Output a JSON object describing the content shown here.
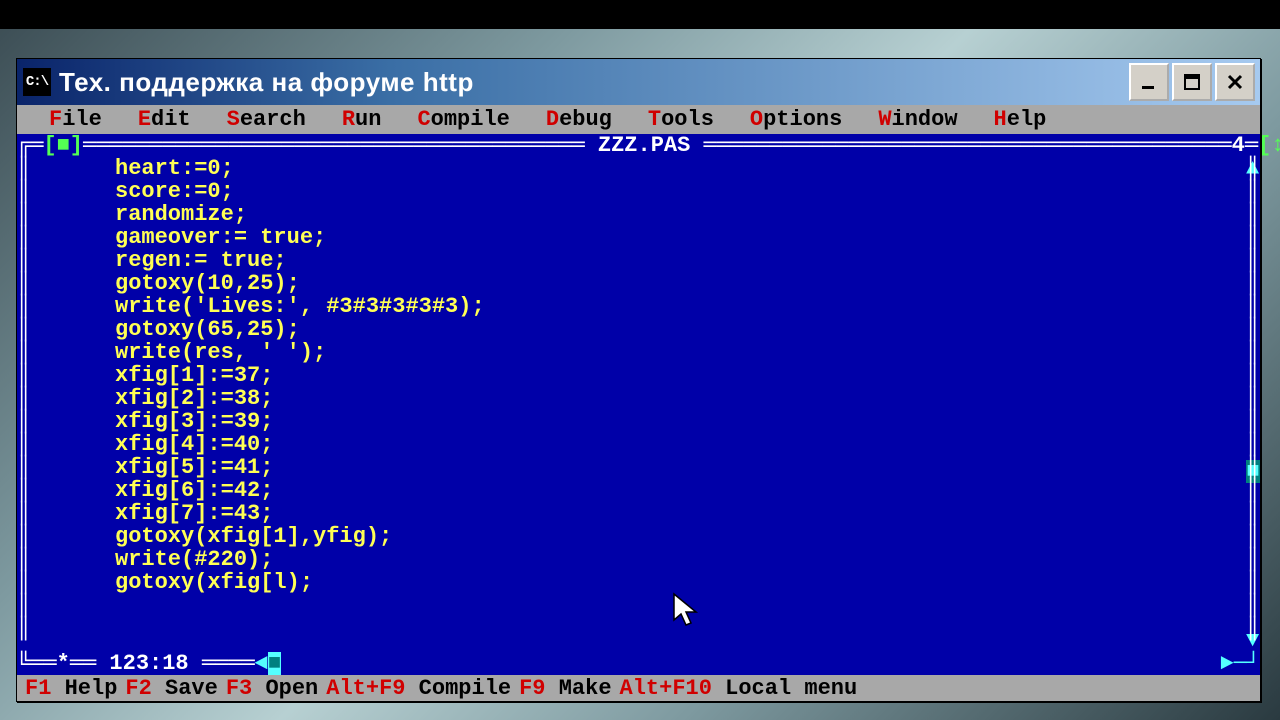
{
  "titlebar": {
    "icon_text": "C:\\",
    "title": "Тех. поддержка на форуме http"
  },
  "menu": {
    "items": [
      {
        "hot": "F",
        "rest": "ile"
      },
      {
        "hot": "E",
        "rest": "dit"
      },
      {
        "hot": "S",
        "rest": "earch"
      },
      {
        "hot": "R",
        "rest": "un"
      },
      {
        "hot": "C",
        "rest": "ompile"
      },
      {
        "hot": "D",
        "rest": "ebug"
      },
      {
        "hot": "T",
        "rest": "ools"
      },
      {
        "hot": "O",
        "rest": "ptions"
      },
      {
        "hot": "W",
        "rest": "indow"
      },
      {
        "hot": "H",
        "rest": "elp"
      }
    ]
  },
  "editor": {
    "filename": "ZZZ.PAS",
    "window_number": "4",
    "cursor_pos": "123:18",
    "lines": [
      "heart:=0;",
      "score:=0;",
      "randomize;",
      "gameover:= true;",
      "regen:= true;",
      "gotoxy(10,25);",
      "write('Lives:', #3#3#3#3#3);",
      "gotoxy(65,25);",
      "write(res, ' ');",
      "xfig[1]:=37;",
      "xfig[2]:=38;",
      "xfig[3]:=39;",
      "xfig[4]:=40;",
      "xfig[5]:=41;",
      "xfig[6]:=42;",
      "xfig[7]:=43;",
      "gotoxy(xfig[1],yfig);",
      "write(#220);",
      "gotoxy(xfig[l);"
    ]
  },
  "statusbar": {
    "items": [
      {
        "hot": "F1",
        "rest": " Help"
      },
      {
        "hot": "F2",
        "rest": " Save"
      },
      {
        "hot": "F3",
        "rest": " Open"
      },
      {
        "hot": "Alt+F9",
        "rest": " Compile"
      },
      {
        "hot": "F9",
        "rest": " Make"
      },
      {
        "hot": "Alt+F10",
        "rest": " Local menu"
      }
    ]
  }
}
